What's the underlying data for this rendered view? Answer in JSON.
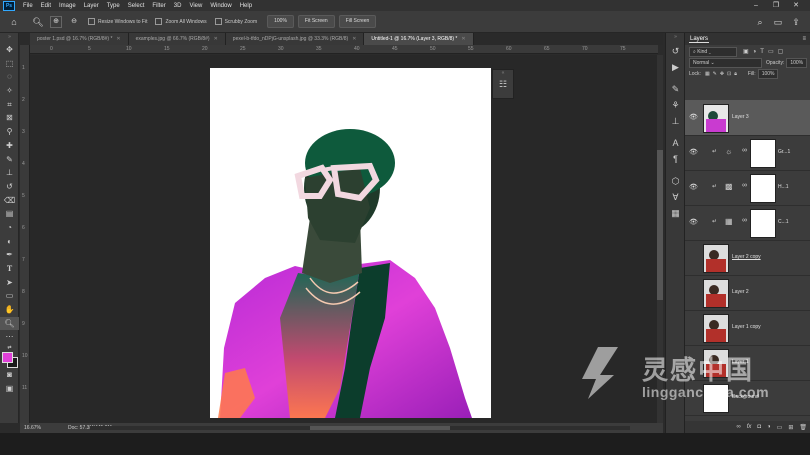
{
  "menu": {
    "app_icon": "Ps",
    "items": [
      "File",
      "Edit",
      "Image",
      "Layer",
      "Type",
      "Select",
      "Filter",
      "3D",
      "View",
      "Window",
      "Help"
    ],
    "window_controls": [
      "–",
      "❐",
      "✕"
    ]
  },
  "options": {
    "resize_windows_label": "Resize Windows to Fit",
    "zoom_all_label": "Zoom All Windows",
    "scrubby_zoom_label": "Scrubby Zoom",
    "zoom_value": "100%",
    "fit_screen_label": "Fit Screen",
    "fill_screen_label": "Fill Screen"
  },
  "tabs": [
    {
      "label": "poster 1.psd @ 16.7% (RGB/8#) *"
    },
    {
      "label": "examples.jpg @ 66.7% (RGB/8#)"
    },
    {
      "label": "pexel-b-tfdo_nDPjG-unsplash.jpg @ 33.3% (RGB/8)"
    },
    {
      "label": "Untitled-1 @ 16.7% (Layer 3, RGB/8) *"
    }
  ],
  "ruler": {
    "h_ticks": [
      "0",
      "5",
      "10",
      "15",
      "20",
      "25",
      "30",
      "35",
      "40",
      "45",
      "50",
      "55",
      "60",
      "65",
      "70",
      "75"
    ],
    "v_ticks": [
      "1",
      "2",
      "3",
      "4",
      "5",
      "6",
      "7",
      "8",
      "9",
      "10",
      "11"
    ]
  },
  "status": {
    "zoom": "16.67%",
    "doc": "Doc: 57.3M/445.0M"
  },
  "layers_panel": {
    "title": "Layers",
    "kind_label": "Kind",
    "blend_mode": "Normal",
    "opacity_label": "Opacity:",
    "opacity_value": "100%",
    "lock_label": "Lock:",
    "fill_label": "Fill:",
    "fill_value": "100%",
    "layers": [
      {
        "name": "Layer 3",
        "selected": true,
        "visible": true,
        "kind": "pixel"
      },
      {
        "name": "Gr...1",
        "selected": false,
        "visible": true,
        "kind": "adjustment"
      },
      {
        "name": "H...1",
        "selected": false,
        "visible": true,
        "kind": "adjustment"
      },
      {
        "name": "C...1",
        "selected": false,
        "visible": true,
        "kind": "adjustment"
      },
      {
        "name": "Layer 2 copy",
        "selected": false,
        "visible": false,
        "kind": "pixel"
      },
      {
        "name": "Layer 2",
        "selected": false,
        "visible": false,
        "kind": "pixel"
      },
      {
        "name": "Layer 1 copy",
        "selected": false,
        "visible": false,
        "kind": "pixel"
      },
      {
        "name": "Layer 1",
        "selected": false,
        "visible": false,
        "kind": "pixel"
      },
      {
        "name": "Background",
        "selected": false,
        "visible": false,
        "kind": "pixel"
      }
    ],
    "footer_icons": [
      "link-icon",
      "fx-icon",
      "mask-icon",
      "adjustment-icon",
      "folder-icon",
      "new-layer-icon",
      "trash-icon"
    ]
  },
  "watermark": {
    "cn": "灵感中国",
    "url": "lingganchina.com"
  },
  "colors": {
    "accent_blue": "#31a8ff",
    "foreground": "#e040d8",
    "background": "#1a1a1a"
  }
}
